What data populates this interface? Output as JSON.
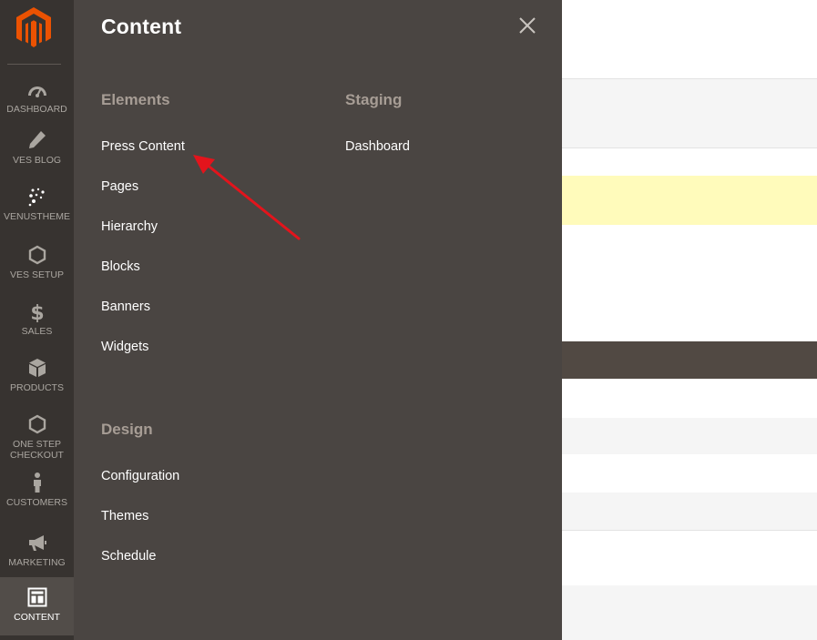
{
  "rail": {
    "items": [
      {
        "label": "DASHBOARD",
        "icon": "dashboard-gauge-icon"
      },
      {
        "label": "VES BLOG",
        "icon": "pencil-icon"
      },
      {
        "label": "VENUSTHEME",
        "icon": "stars-icon"
      },
      {
        "label": "VES SETUP",
        "icon": "hexagon-icon"
      },
      {
        "label": "SALES",
        "icon": "dollar-icon"
      },
      {
        "label": "PRODUCTS",
        "icon": "box-icon"
      },
      {
        "label": "ONE STEP CHECKOUT",
        "icon": "hexagon-icon"
      },
      {
        "label": "CUSTOMERS",
        "icon": "person-icon"
      },
      {
        "label": "MARKETING",
        "icon": "megaphone-icon"
      },
      {
        "label": "CONTENT",
        "icon": "layout-icon"
      }
    ],
    "active": "CONTENT"
  },
  "panel": {
    "title": "Content",
    "groups": {
      "elements": {
        "title": "Elements",
        "items": [
          "Press Content",
          "Pages",
          "Hierarchy",
          "Blocks",
          "Banners",
          "Widgets"
        ]
      },
      "staging": {
        "title": "Staging",
        "items": [
          "Dashboard"
        ]
      },
      "design": {
        "title": "Design",
        "items": [
          "Configuration",
          "Themes",
          "Schedule"
        ]
      }
    }
  },
  "colors": {
    "rail_bg": "#373330",
    "panel_bg": "#4a4542",
    "logo": "#eb5202",
    "annotation_arrow": "#e3141c"
  }
}
